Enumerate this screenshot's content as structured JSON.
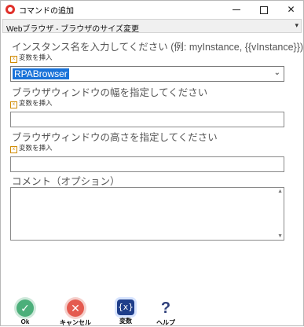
{
  "window": {
    "title": "コマンドの追加",
    "minimize_label": "",
    "maximize_label": "",
    "close_label": "✕"
  },
  "command_select": {
    "value": "Webブラウザ - ブラウザのサイズ変更",
    "arrow": "▾"
  },
  "fields": {
    "instance": {
      "label": "インスタンス名を入力してください (例: myInstance, {{vInstance}})",
      "insert_var": "変数を挿入",
      "value": "RPABrowser",
      "arrow": "⌄"
    },
    "width": {
      "label": "ブラウザウィンドウの幅を指定してください",
      "insert_var": "変数を挿入",
      "value": ""
    },
    "height": {
      "label": "ブラウザウィンドウの高さを指定してください",
      "insert_var": "変数を挿入",
      "value": ""
    },
    "comment": {
      "label": "コメント（オプション）",
      "value": ""
    }
  },
  "actions": {
    "ok": {
      "label": "Ok",
      "glyph": "✓"
    },
    "cancel": {
      "label": "キャンセル",
      "glyph": "✕"
    },
    "variables": {
      "label": "変数",
      "glyph": "{x}"
    },
    "help": {
      "label": "ヘルプ",
      "glyph": "?"
    }
  },
  "colors": {
    "ok": "#4caf7a",
    "cancel": "#e45a4f",
    "variables": "#1f3e8a",
    "help": "#2d3e7a",
    "selection": "#1a73d9"
  }
}
